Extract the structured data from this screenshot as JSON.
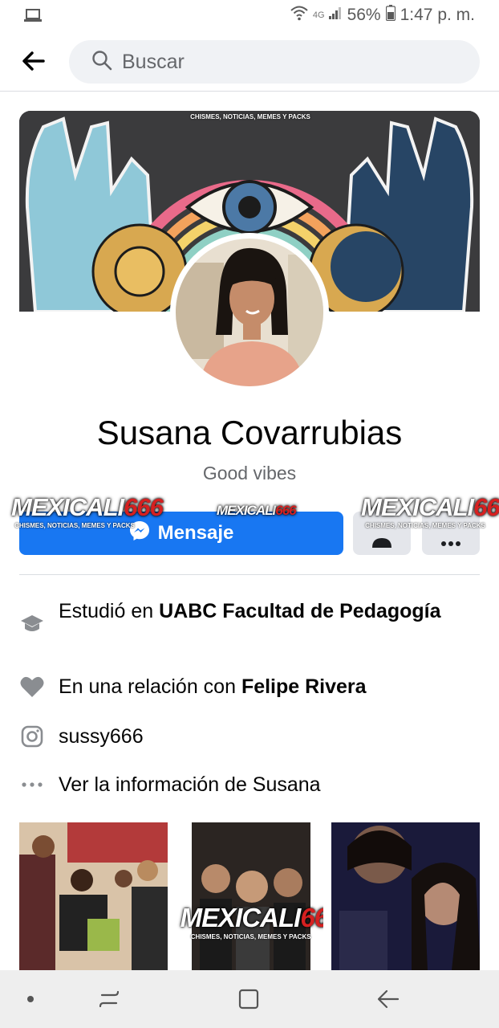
{
  "status_bar": {
    "network": "4G",
    "battery": "56%",
    "time": "1:47 p. m.",
    "icons": [
      "laptop-icon",
      "wifi-icon",
      "signal-icon",
      "battery-icon"
    ]
  },
  "topbar": {
    "search_placeholder": "Buscar",
    "icons": [
      "back-arrow-icon",
      "search-icon"
    ]
  },
  "watermark": {
    "brand": "MEXICALI",
    "brand_number": "666",
    "tagline": "CHISMES, NOTICIAS, MEMES Y PACKS"
  },
  "profile": {
    "name": "Susana Covarrubias",
    "bio": "Good vibes",
    "message_button": "Mensaje"
  },
  "info": {
    "education_prefix": "Estudió en ",
    "education_place": "UABC Facultad de Pedagogía",
    "relationship_prefix": "En una relación con ",
    "relationship_partner": "Felipe Rivera",
    "instagram": "sussy666",
    "see_more": "Ver la información de Susana"
  },
  "colors": {
    "accent": "#1877f2",
    "background": "#ffffff",
    "secondary_text": "#65676b",
    "button_gray": "#e4e6eb",
    "watermark_red": "#d62020"
  }
}
